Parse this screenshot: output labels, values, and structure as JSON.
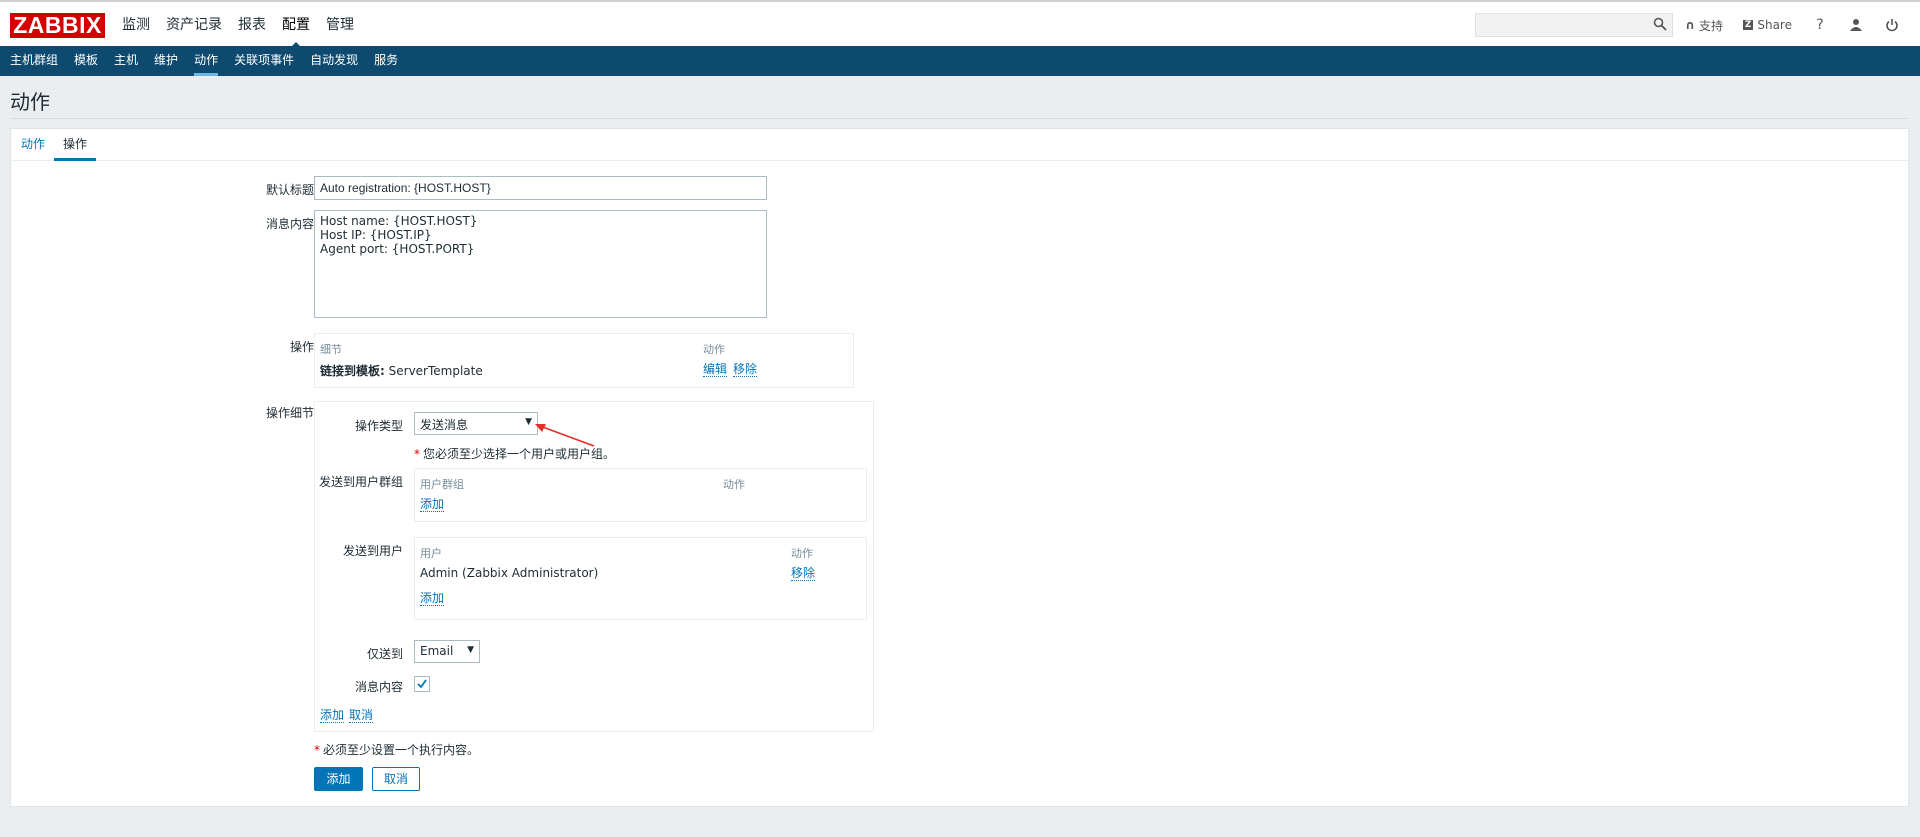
{
  "brand": {
    "logo": "ZABBIX",
    "color": "#d40000"
  },
  "main_menu": [
    "监测",
    "资产记录",
    "报表",
    "配置",
    "管理"
  ],
  "main_menu_selected": "配置",
  "top_right": {
    "support": "支持",
    "share": "Share",
    "help": "?"
  },
  "sub_menu": [
    "主机群组",
    "模板",
    "主机",
    "维护",
    "动作",
    "关联项事件",
    "自动发现",
    "服务"
  ],
  "sub_menu_selected": "动作",
  "page_title": "动作",
  "tabs": [
    "动作",
    "操作"
  ],
  "tab_selected": "操作",
  "form": {
    "default_subject_label": "默认标题",
    "default_subject_value": "Auto registration: {HOST.HOST}",
    "message_label": "消息内容",
    "message_value": "Host name: {HOST.HOST}\nHost IP: {HOST.IP}\nAgent port: {HOST.PORT}",
    "operations_label": "操作",
    "operations_table": {
      "col_details": "细节",
      "col_action": "动作",
      "row_details_bold": "链接到模板:",
      "row_details_value": "ServerTemplate",
      "row_edit": "编辑",
      "row_remove": "移除"
    },
    "op_details_label": "操作细节",
    "op_type_label": "操作类型",
    "op_type_value": "发送消息",
    "op_required_note": "您必须至少选择一个用户或用户组。",
    "send_groups_label": "发送到用户群组",
    "groups_col_group": "用户群组",
    "groups_col_action": "动作",
    "groups_add": "添加",
    "send_users_label": "发送到用户",
    "users_col_user": "用户",
    "users_col_action": "动作",
    "users_row_name": "Admin (Zabbix Administrator)",
    "users_row_remove": "移除",
    "users_add": "添加",
    "send_only_label": "仅送到",
    "send_only_value": "Email",
    "msg_content_label": "消息内容",
    "msg_content_checked": true,
    "inner_add": "添加",
    "inner_cancel": "取消",
    "required_note": "必须至少设置一个执行内容。",
    "btn_add": "添加",
    "btn_cancel": "取消"
  }
}
